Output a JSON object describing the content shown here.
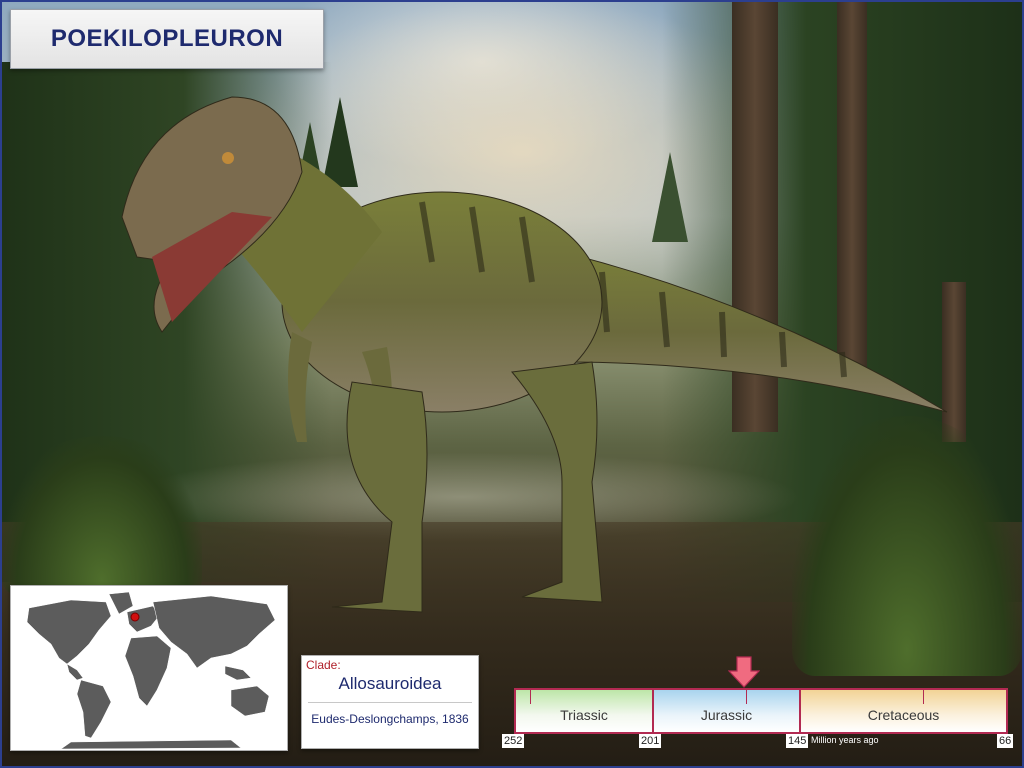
{
  "title": "POEKILOPLEURON",
  "clade": {
    "label": "Clade:",
    "name": "Allosauroidea",
    "author": "Eudes-Deslongchamps, 1836"
  },
  "timeline": {
    "periods": [
      "Triassic",
      "Jurassic",
      "Cretaceous"
    ],
    "ticks": [
      "252",
      "201",
      "145",
      "66"
    ],
    "unit": "Million years ago",
    "marker_period": "Jurassic"
  },
  "map": {
    "location_marker": "France (Europe)"
  },
  "colors": {
    "title_text": "#1e2a6e",
    "timeline_border": "#b22a52",
    "marker": "#f06b80",
    "map_land": "#5c5c5c",
    "map_dot": "#d01010"
  }
}
